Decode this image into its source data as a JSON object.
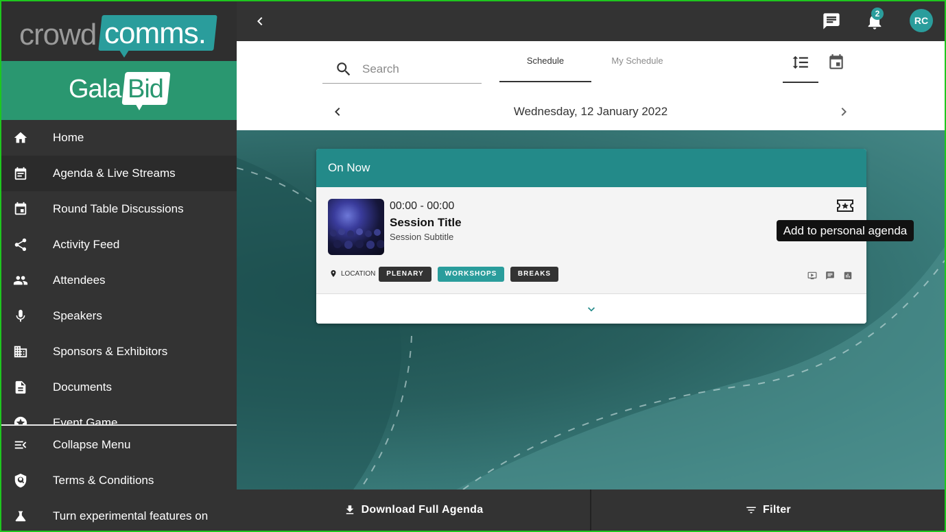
{
  "brand": {
    "crowd": "crowd",
    "comms": "comms.",
    "gala": "Gala",
    "bid": "Bid"
  },
  "sidebar": {
    "items": [
      {
        "label": "Home",
        "icon": "home-icon"
      },
      {
        "label": "Agenda & Live Streams",
        "icon": "agenda-icon",
        "active": true
      },
      {
        "label": "Round Table Discussions",
        "icon": "calendar-event-icon"
      },
      {
        "label": "Activity Feed",
        "icon": "share-icon"
      },
      {
        "label": "Attendees",
        "icon": "people-icon"
      },
      {
        "label": "Speakers",
        "icon": "microphone-icon"
      },
      {
        "label": "Sponsors & Exhibitors",
        "icon": "building-icon"
      },
      {
        "label": "Documents",
        "icon": "document-icon"
      },
      {
        "label": "Event Game",
        "icon": "star-badge-icon"
      }
    ],
    "bottom_items": [
      {
        "label": "Collapse Menu",
        "icon": "collapse-menu-icon"
      },
      {
        "label": "Terms & Conditions",
        "icon": "shield-icon"
      },
      {
        "label": "Turn experimental features on",
        "icon": "flask-icon"
      }
    ]
  },
  "topbar": {
    "notification_count": "2",
    "avatar_initials": "RC"
  },
  "header": {
    "search_placeholder": "Search",
    "tabs": [
      {
        "label": "Schedule",
        "active": true
      },
      {
        "label": "My Schedule",
        "active": false
      }
    ],
    "date": "Wednesday, 12 January 2022"
  },
  "card": {
    "heading": "On Now",
    "time": "00:00 - 00:00",
    "title": "Session Title",
    "subtitle": "Session Subtitle",
    "location_label": "LOCATION",
    "tags": [
      "PLENARY",
      "WORKSHOPS",
      "BREAKS"
    ],
    "tooltip": "Add to personal agenda"
  },
  "bottombar": {
    "download_label": "Download Full Agenda",
    "filter_label": "Filter"
  },
  "colors": {
    "accent": "#2a9d9c",
    "galabid_green": "#2a9770",
    "sidebar_bg": "#333333"
  }
}
